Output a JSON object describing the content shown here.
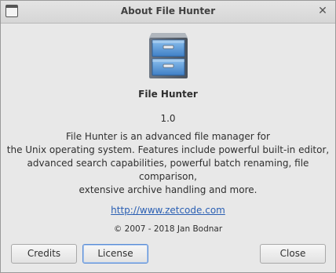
{
  "window": {
    "title": "About File Hunter"
  },
  "app": {
    "icon": "file-cabinet-icon",
    "name": "File Hunter",
    "version": "1.0",
    "description_lines": [
      "File Hunter is an advanced file manager for",
      "the Unix operating system. Features include powerful built-in editor,",
      "advanced search capabilities, powerful batch renaming, file comparison,",
      "extensive archive handling and more."
    ],
    "website": "http://www.zetcode.com",
    "copyright": "© 2007 - 2018 Jan Bodnar"
  },
  "buttons": {
    "credits": "Credits",
    "license": "License",
    "close": "Close"
  },
  "colors": {
    "link": "#2a5fb3",
    "focus_border": "#5b8dd6",
    "cabinet_blue": "#4a86c9"
  }
}
